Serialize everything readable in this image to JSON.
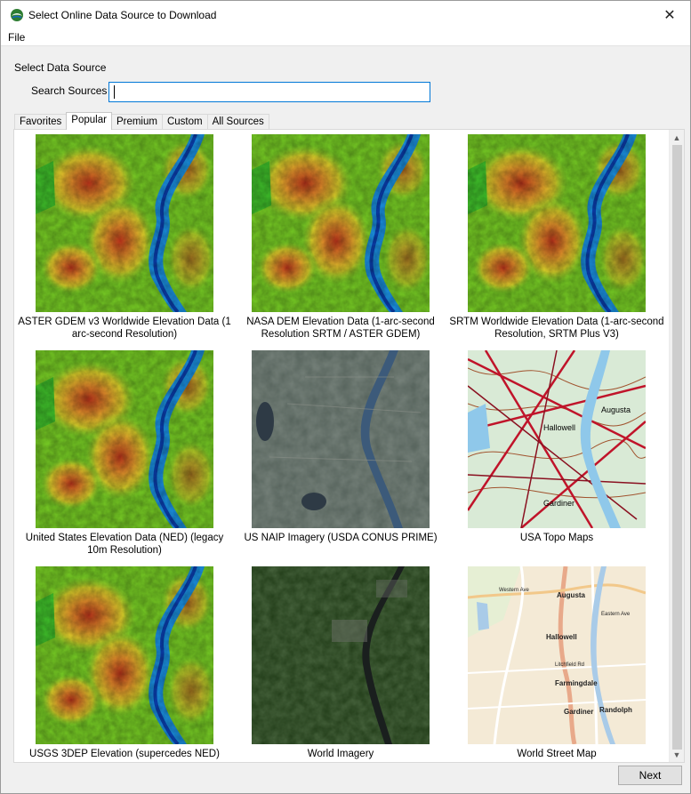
{
  "window": {
    "title": "Select Online Data Source to Download",
    "app_icon": "globe-icon",
    "close_label": "✕"
  },
  "menu": {
    "file": "File"
  },
  "form": {
    "group_label": "Select Data Source",
    "search_label": "Search Sources",
    "search_value": "",
    "search_placeholder": ""
  },
  "tabs": [
    {
      "label": "Favorites",
      "active": false
    },
    {
      "label": "Popular",
      "active": true
    },
    {
      "label": "Premium",
      "active": false
    },
    {
      "label": "Custom",
      "active": false
    },
    {
      "label": "All Sources",
      "active": false
    }
  ],
  "sources": [
    {
      "label": "ASTER GDEM v3 Worldwide Elevation Data (1 arc-second Resolution)",
      "thumb": "elevation-relief"
    },
    {
      "label": "NASA DEM Elevation Data (1-arc-second Resolution SRTM / ASTER GDEM)",
      "thumb": "elevation-relief"
    },
    {
      "label": "SRTM Worldwide Elevation Data (1-arc-second Resolution, SRTM Plus V3)",
      "thumb": "elevation-relief"
    },
    {
      "label": "United States Elevation Data (NED) (legacy 10m Resolution)",
      "thumb": "elevation-relief"
    },
    {
      "label": "US NAIP Imagery (USDA CONUS PRIME)",
      "thumb": "aerial-imagery"
    },
    {
      "label": "USA Topo Maps",
      "thumb": "topo-map"
    },
    {
      "label": "USGS 3DEP Elevation (supercedes NED)",
      "thumb": "elevation-relief"
    },
    {
      "label": "World Imagery",
      "thumb": "satellite-imagery"
    },
    {
      "label": "World Street Map",
      "thumb": "street-map"
    }
  ],
  "street_map_labels": [
    "Augusta",
    "Hallowell",
    "Farmingdale",
    "Gardiner",
    "Randolph",
    "Western Ave",
    "Eastern Ave",
    "Litchfield Rd"
  ],
  "topo_map_labels": [
    "Hallowell",
    "Augusta",
    "Gardiner"
  ],
  "colors": {
    "accent": "#0078d7",
    "elevation_low": "#1db31d",
    "elevation_high": "#c4421a",
    "river": "#1a8fe0"
  },
  "buttons": {
    "next": "Next"
  },
  "scrollbar": {
    "up": "▲",
    "down": "▼"
  }
}
